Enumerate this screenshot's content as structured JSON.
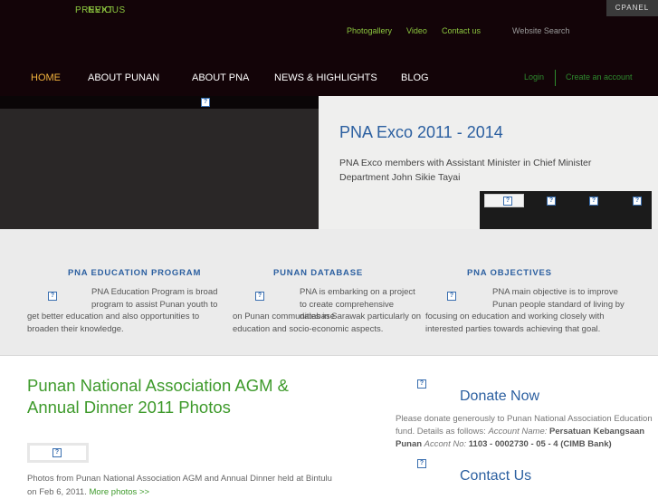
{
  "header": {
    "prev_label": "PREVIOUS",
    "next_label": "NEXT",
    "cpanel_label": "CPANEL",
    "top_links": [
      "Photogallery",
      "Video",
      "Contact us"
    ],
    "search_placeholder": "Website Search",
    "account": {
      "login": "Login",
      "create": "Create an account"
    }
  },
  "nav": {
    "items": [
      "HOME",
      "ABOUT PUNAN",
      "ABOUT PNA",
      "NEWS & HIGHLIGHTS",
      "BLOG"
    ],
    "active": "HOME"
  },
  "slideshow": {
    "caption_title": "PNA Exco 2011 - 2014",
    "caption_desc": "PNA Exco members with Assistant Minister in Chief Minister Department John Sikie Tayai"
  },
  "pillars": [
    {
      "title": "PNA EDUCATION PROGRAM",
      "text_inline": "PNA Education Program is broad program to assist Punan youth to",
      "text_rest": "get better education and also opportunities to broaden their knowledge."
    },
    {
      "title": "PUNAN DATABASE",
      "text_inline": "PNA is embarking on a project to create comprehensive database",
      "text_rest": "on Punan communities in Sarawak particularly on education and socio-economic aspects."
    },
    {
      "title": "PNA OBJECTIVES",
      "text_inline": "PNA main objective is to improve Punan people standard of living by",
      "text_rest": "focusing on education and working closely with interested parties towards achieving that goal."
    }
  ],
  "article": {
    "title": "Punan National Association AGM & Annual Dinner 2011 Photos",
    "text": "Photos from Punan National Association AGM and Annual Dinner held at Bintulu on Feb 6, 2011.",
    "more_link": "More photos >>"
  },
  "donate": {
    "title": "Donate Now",
    "text": "Please donate generously to Punan National Association Education fund. Details as follows:",
    "account_name_label": "Account Name:",
    "account_name": "Persatuan Kebangsaan Punan",
    "account_no_label": "Accont No:",
    "account_no": "1103 - 0002730 - 05 - 4 (CIMB Bank)"
  },
  "contact": {
    "title": "Contact Us"
  },
  "icons": {
    "image_placeholder": "?"
  },
  "colors": {
    "accent_green": "#8cc63f",
    "title_blue": "#2b5fa0",
    "nav_active": "#f3b33d",
    "header_bg": "#130408"
  }
}
